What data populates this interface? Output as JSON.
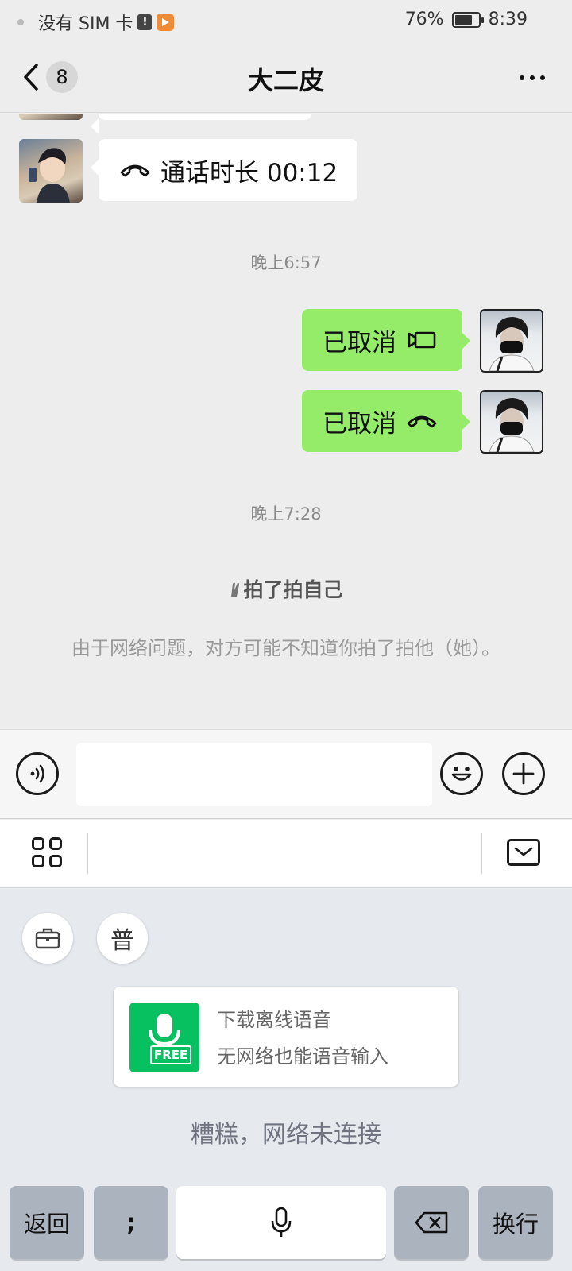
{
  "status_bar": {
    "carrier": "没有 SIM 卡",
    "battery_percent_text": "76%",
    "battery_level": 0.76,
    "time": "8:39"
  },
  "header": {
    "unread_count": "8",
    "title": "大二皮"
  },
  "messages": {
    "call_incoming": "通话时长 00:12",
    "time_1": "晚上6:57",
    "out_video_cancelled": "已取消",
    "out_voice_cancelled": "已取消",
    "time_2": "晚上7:28",
    "pat_text": "拍了拍自己",
    "pat_note": "由于网络问题，对方可能不知道你拍了拍他（她）。"
  },
  "input": {
    "value": "",
    "placeholder": ""
  },
  "keyboard": {
    "mode_chip": "普",
    "offline_card": {
      "badge": "FREE",
      "title": "下载离线语音",
      "subtitle": "无网络也能语音输入"
    },
    "network_error": "糟糕，网络未连接",
    "keys": {
      "back": "返回",
      "semicolon": ";",
      "enter": "换行"
    }
  },
  "colors": {
    "outgoing_bubble": "#95ec69",
    "accent_green": "#07c160",
    "background": "#ededed"
  }
}
